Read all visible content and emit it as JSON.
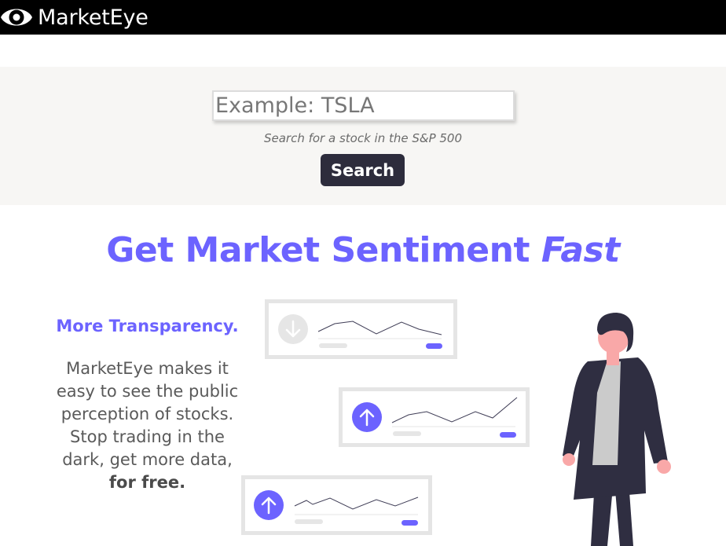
{
  "header": {
    "brand": "MarketEye",
    "logo_icon": "eye-icon",
    "background": "#000000"
  },
  "search": {
    "placeholder": "Example: TSLA",
    "value": "",
    "hint": "Search for a stock in the S&P 500",
    "button_label": "Search",
    "button_color": "#2d2c3c"
  },
  "hero": {
    "title": "Get Market Sentiment",
    "title_emphasis": "Fast",
    "accent_color": "#6c63ff"
  },
  "feature": {
    "title": "More Transparency.",
    "body": "MarketEye makes it easy to see the public perception of stocks. Stop trading in the dark, get more data,",
    "body_emphasis": "for free."
  },
  "illustration": {
    "cards": [
      {
        "trend": "down",
        "icon": "arrow-down-icon",
        "state": "inactive"
      },
      {
        "trend": "up",
        "icon": "arrow-up-icon",
        "state": "active"
      },
      {
        "trend": "up",
        "icon": "arrow-up-icon",
        "state": "active"
      }
    ],
    "person": "person-illustration"
  }
}
